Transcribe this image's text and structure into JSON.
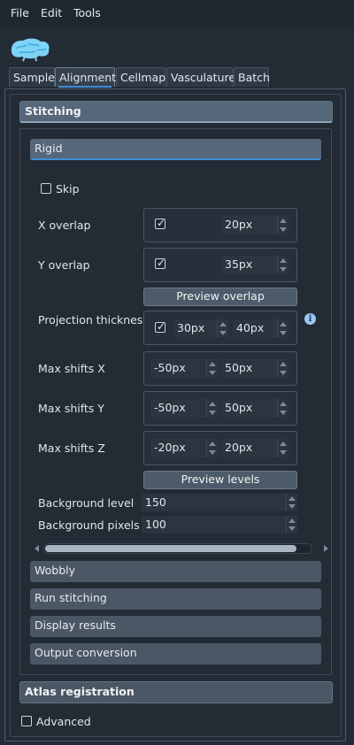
{
  "menubar": {
    "file": "File",
    "edit": "Edit",
    "tools": "Tools"
  },
  "tabs": [
    "Sample",
    "Alignment",
    "Cellmap",
    "Vasculature",
    "Batch"
  ],
  "active_tab": "Alignment",
  "stitching": {
    "header": "Stitching",
    "rigid": {
      "header": "Rigid",
      "skip_label": "Skip",
      "skip_checked": false,
      "x_overlap": {
        "label": "X overlap",
        "checked": true,
        "value": "20px"
      },
      "y_overlap": {
        "label": "Y overlap",
        "checked": true,
        "value": "35px"
      },
      "preview_overlap_label": "Preview overlap",
      "projection_thickness": {
        "label": "Projection thickness",
        "checked": true,
        "value1": "30px",
        "value2": "40px"
      },
      "max_shifts_x": {
        "label": "Max shifts X",
        "value1": "-50px",
        "value2": "50px"
      },
      "max_shifts_y": {
        "label": "Max shifts Y",
        "value1": "-50px",
        "value2": "50px"
      },
      "max_shifts_z": {
        "label": "Max shifts Z",
        "value1": "-20px",
        "value2": "20px"
      },
      "preview_levels_label": "Preview levels",
      "background_level": {
        "label": "Background level",
        "value": "150"
      },
      "background_pixels": {
        "label": "Background pixels",
        "value": "100"
      }
    },
    "sections": [
      "Wobbly",
      "Run stitching",
      "Display results",
      "Output conversion"
    ]
  },
  "atlas_registration": "Atlas registration",
  "advanced": {
    "label": "Advanced",
    "checked": false
  },
  "colors": {
    "accent": "#3d8fd6",
    "background": "#232b35",
    "header": "#4b5765"
  }
}
